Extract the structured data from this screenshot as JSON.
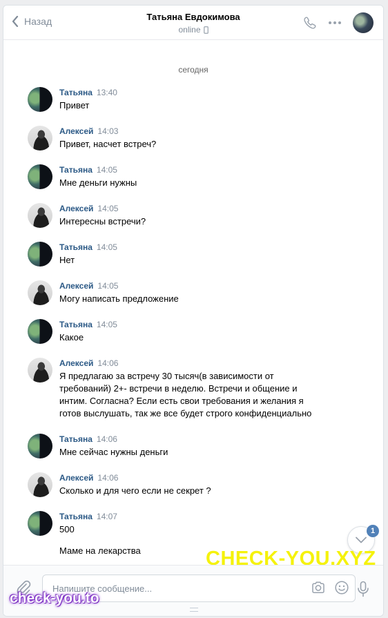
{
  "header": {
    "back_label": "Назад",
    "name": "Татьяна Евдокимова",
    "status": "online"
  },
  "date_separator": "сегодня",
  "messages": [
    {
      "author": "Татьяна",
      "time": "13:40",
      "text": "Привет",
      "avatar": "tatyana"
    },
    {
      "author": "Алексей",
      "time": "14:03",
      "text": "Привет, насчет встреч?",
      "avatar": "aleksey"
    },
    {
      "author": "Татьяна",
      "time": "14:05",
      "text": "Мне деньги нужны",
      "avatar": "tatyana"
    },
    {
      "author": "Алексей",
      "time": "14:05",
      "text": "Интересны встречи?",
      "avatar": "aleksey"
    },
    {
      "author": "Татьяна",
      "time": "14:05",
      "text": "Нет",
      "avatar": "tatyana"
    },
    {
      "author": "Алексей",
      "time": "14:05",
      "text": "Могу написать предложение",
      "avatar": "aleksey"
    },
    {
      "author": "Татьяна",
      "time": "14:05",
      "text": "Какое",
      "avatar": "tatyana"
    },
    {
      "author": "Алексей",
      "time": "14:06",
      "text": "Я предлагаю за встречу 30 тысяч(в зависимости от\nтребований) 2+- встречи в неделю. Встречи и общение и\nинтим. Согласна? Если есть свои требования и желания я\nготов выслушать, так же все будет строго конфиденциально",
      "avatar": "aleksey"
    },
    {
      "author": "Татьяна",
      "time": "14:06",
      "text": "Мне сейчас нужны деньги",
      "avatar": "tatyana"
    },
    {
      "author": "Алексей",
      "time": "14:06",
      "text": "Сколько и для чего если не секрет ?",
      "avatar": "aleksey"
    },
    {
      "author": "Татьяна",
      "time": "14:07",
      "text": "500",
      "extra": "Маме на лекарства",
      "avatar": "tatyana"
    }
  ],
  "unread_count": "1",
  "composer": {
    "placeholder": "Напишите сообщение..."
  },
  "watermarks": {
    "top": "CHECK-YOU.XYZ",
    "bottom": "check-you.to"
  },
  "colors": {
    "author": "#2a5885",
    "badge": "#5181b8",
    "watermark_top": "#f5f20c"
  }
}
